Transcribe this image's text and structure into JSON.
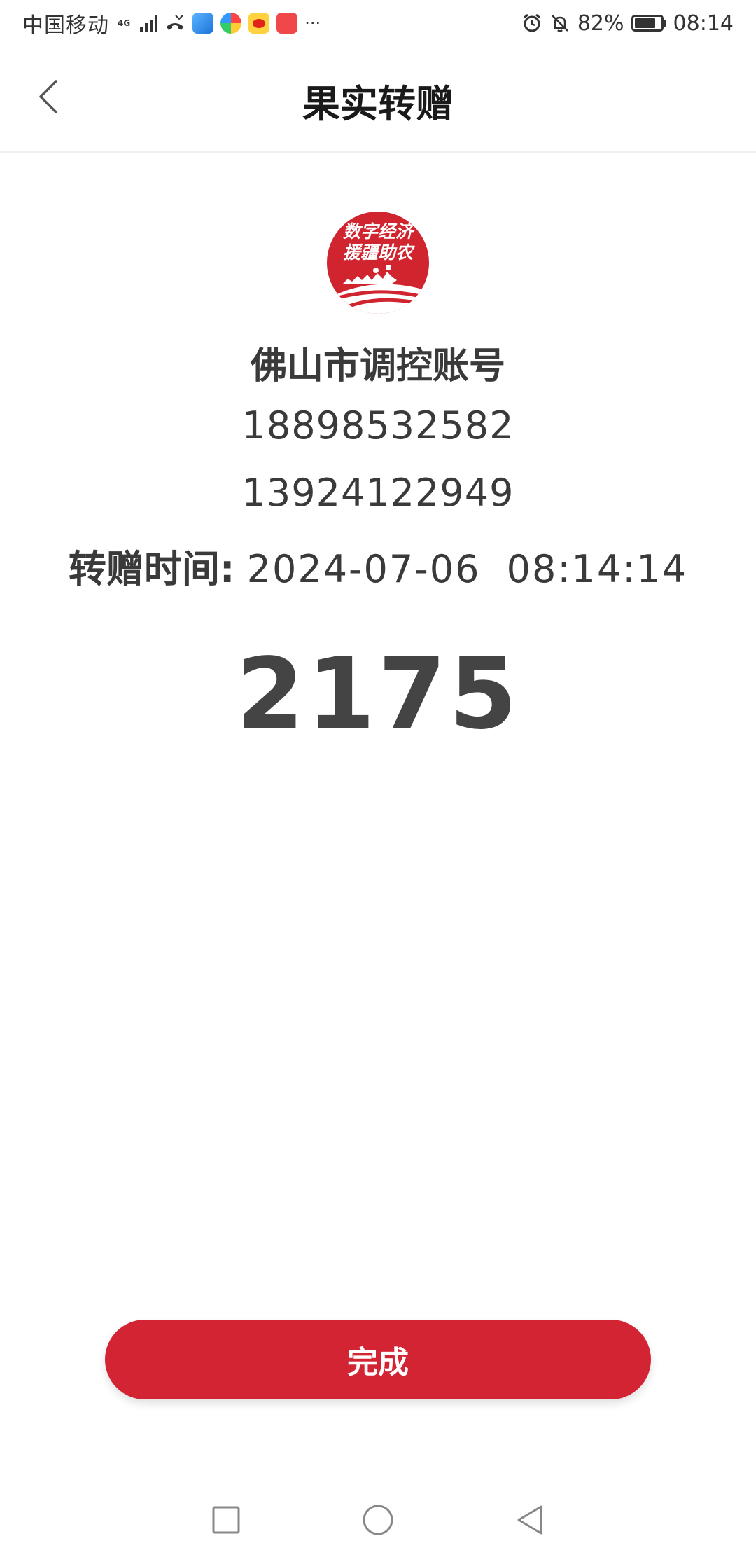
{
  "status_bar": {
    "carrier": "中国移动",
    "network": "4G",
    "battery": "82%",
    "battery_level": 0.82,
    "time": "08:14",
    "more": "···",
    "icons": [
      "missed-call-icon",
      "app-icon",
      "app-icon",
      "weibo-icon",
      "app-icon",
      "alarm-icon",
      "mute-icon",
      "battery-icon"
    ]
  },
  "header": {
    "title": "果实转赠",
    "back_icon": "chevron-left-icon"
  },
  "logo": {
    "line1": "数字经济",
    "line2": "援疆助农",
    "color": "#d0242f"
  },
  "transfer": {
    "account_name": "佛山市调控账号",
    "phone_1": "18898532582",
    "phone_2": "13924122949",
    "time_label": "转赠时间:",
    "time_value": "2024-07-06 08:14:14",
    "amount": "2175"
  },
  "actions": {
    "done_label": "完成",
    "accent_color": "#d22433"
  },
  "nav_bar": {
    "icons": [
      "square-icon",
      "circle-icon",
      "triangle-back-icon"
    ]
  }
}
